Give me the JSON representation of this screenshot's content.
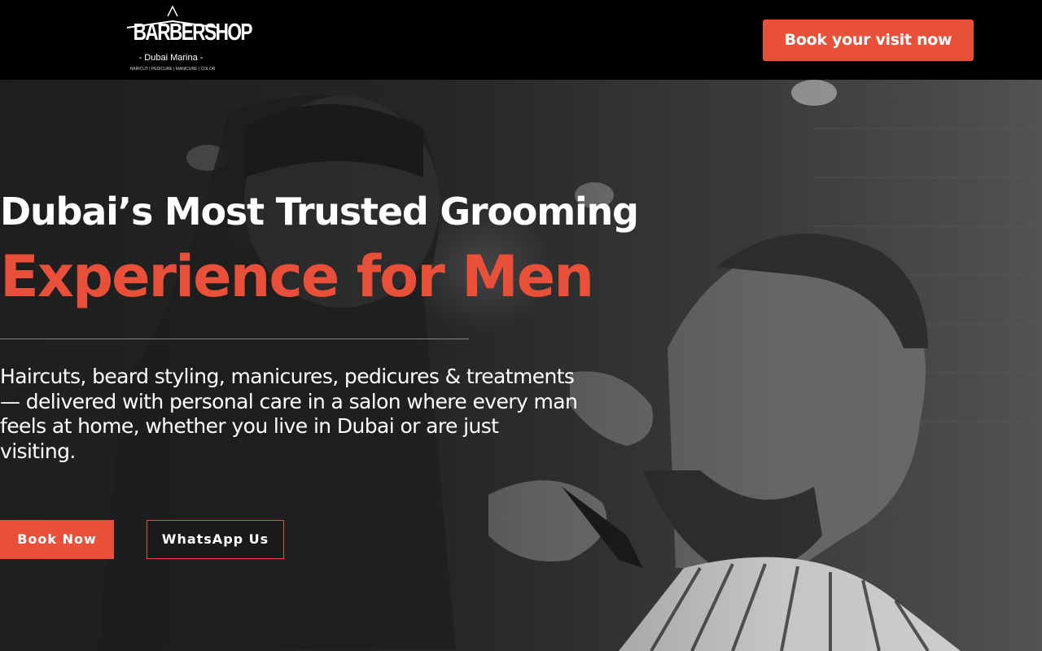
{
  "header": {
    "logo": {
      "brand": "BARBERSHOP",
      "location": "- Dubai Marina -",
      "services_line": "HAIRCUT | PEDICURE | MANICURE | COLOR"
    },
    "cta_label": "Book your visit now"
  },
  "hero": {
    "headline_line1": "Dubai’s Most Trusted Grooming",
    "headline_line2": "Experience for Men",
    "description": "Haircuts, beard styling, manicures, pedicures & treatments — delivered with personal care in a salon where every man feels at home, whether you live in Dubai or are just visiting.",
    "primary_button": "Book Now",
    "secondary_button": "WhatsApp Us"
  },
  "colors": {
    "accent": "#e9503a",
    "header_bg": "#000000",
    "text": "#ffffff"
  }
}
